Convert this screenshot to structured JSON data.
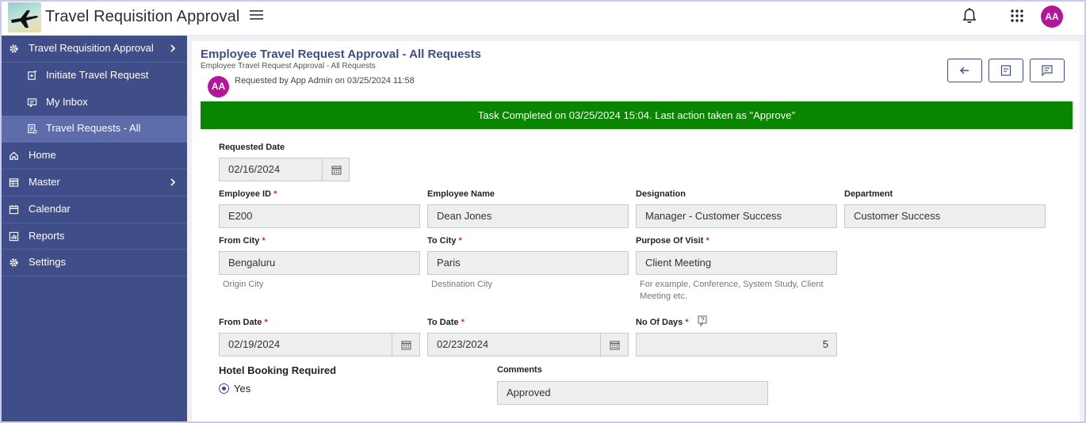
{
  "app": {
    "title": "Travel Requisition Approval",
    "avatar_initials": "AA",
    "avatar_color": "#b5149b"
  },
  "sidebar": {
    "items": [
      {
        "label": "Travel Requisition Approval",
        "icon": "gear-icon",
        "has_chevron": true
      },
      {
        "label": "Initiate Travel Request",
        "icon": "document-plus-icon",
        "sub": true
      },
      {
        "label": "My Inbox",
        "icon": "inbox-icon",
        "sub": true
      },
      {
        "label": "Travel Requests - All",
        "icon": "list-icon",
        "sub": true,
        "active": true
      },
      {
        "label": "Home",
        "icon": "home-icon"
      },
      {
        "label": "Master",
        "icon": "table-icon",
        "has_chevron": true
      },
      {
        "label": "Calendar",
        "icon": "calendar-icon"
      },
      {
        "label": "Reports",
        "icon": "bar-chart-icon"
      },
      {
        "label": "Settings",
        "icon": "gear-icon"
      }
    ],
    "bg_color": "#3f4d88",
    "active_color": "#5d6cab"
  },
  "page": {
    "title": "Employee Travel Request Approval - All Requests",
    "subtitle": "Employee Travel Request Approval - All Requests",
    "requester_initials": "AA",
    "requested_text": "Requested by App Admin on 03/25/2024 11:58"
  },
  "banner": {
    "text": "Task Completed on 03/25/2024 15:04. Last action taken as \"Approve\"",
    "color": "#0a8500"
  },
  "form": {
    "requested_date": {
      "label": "Requested Date",
      "value": "02/16/2024"
    },
    "employee_id": {
      "label": "Employee ID",
      "value": "E200",
      "required": true
    },
    "employee_name": {
      "label": "Employee Name",
      "value": "Dean Jones"
    },
    "designation": {
      "label": "Designation",
      "value": "Manager - Customer Success"
    },
    "department": {
      "label": "Department",
      "value": "Customer Success"
    },
    "from_city": {
      "label": "From City",
      "value": "Bengaluru",
      "hint": "Origin City",
      "required": true
    },
    "to_city": {
      "label": "To City",
      "value": "Paris",
      "hint": "Destination City",
      "required": true
    },
    "purpose": {
      "label": "Purpose Of Visit",
      "value": "Client Meeting",
      "hint": "For example, Conference, System Study, Client Meeting etc.",
      "required": true
    },
    "from_date": {
      "label": "From Date",
      "value": "02/19/2024",
      "required": true
    },
    "to_date": {
      "label": "To Date",
      "value": "02/23/2024",
      "required": true
    },
    "no_of_days": {
      "label": "No Of Days",
      "value": "5",
      "required": true
    },
    "hotel_booking": {
      "label": "Hotel Booking Required",
      "option": "Yes"
    },
    "comments": {
      "label": "Comments",
      "value": "Approved"
    },
    "required_marker": "*"
  }
}
